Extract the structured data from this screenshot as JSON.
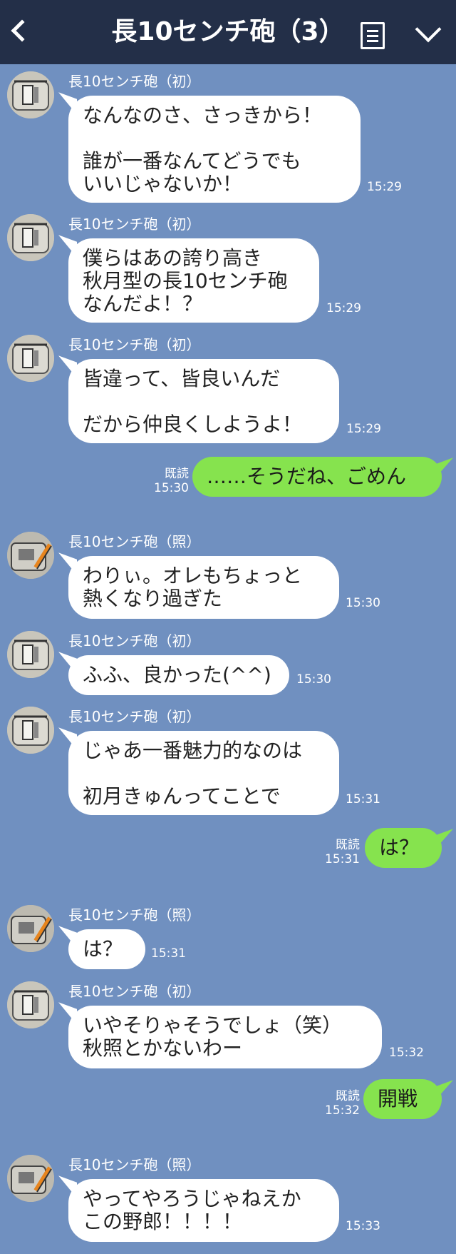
{
  "header": {
    "back_icon": "chevron-left-icon",
    "title": "長10センチ砲（3）",
    "menu_icon": "notes-icon",
    "expand_icon": "chevron-down-icon"
  },
  "messages": [
    {
      "sender": "長10センチ砲（初）",
      "text": "なんなのさ、さっきから！\n\n誰が一番なんてどうでも\nいいじゃないか！",
      "time": "15:29"
    },
    {
      "sender": "長10センチ砲（初）",
      "text": "僕らはあの誇り高き\n秋月型の長10センチ砲\nなんだよ！？",
      "time": "15:29"
    },
    {
      "sender": "長10センチ砲（初）",
      "text": "皆違って、皆良いんだ\n\nだから仲良くしようよ！",
      "time": "15:29"
    },
    {
      "self": true,
      "read_label": "既読",
      "time": "15:30",
      "text": "……そうだね、ごめん"
    },
    {
      "sender": "長10センチ砲（照）",
      "text": "わりぃ。オレもちょっと\n熱くなり過ぎた",
      "time": "15:30"
    },
    {
      "sender": "長10センチ砲（初）",
      "text": "ふふ、良かった(^^)",
      "time": "15:30"
    },
    {
      "sender": "長10センチ砲（初）",
      "text": "じゃあ一番魅力的なのは\n\n初月きゅんってことで",
      "time": "15:31"
    },
    {
      "self": true,
      "read_label": "既読",
      "time": "15:31",
      "text": "は？"
    },
    {
      "sender": "長10センチ砲（照）",
      "text": "は？",
      "time": "15:31"
    },
    {
      "sender": "長10センチ砲（初）",
      "text": "いやそりゃそうでしょ（笑）\n秋照とかないわー",
      "time": "15:32"
    },
    {
      "self": true,
      "read_label": "既読",
      "time": "15:32",
      "text": "開戦"
    },
    {
      "sender": "長10センチ砲（照）",
      "text": "やってやろうじゃねえか\nこの野郎！！！！",
      "time": "15:33"
    }
  ]
}
